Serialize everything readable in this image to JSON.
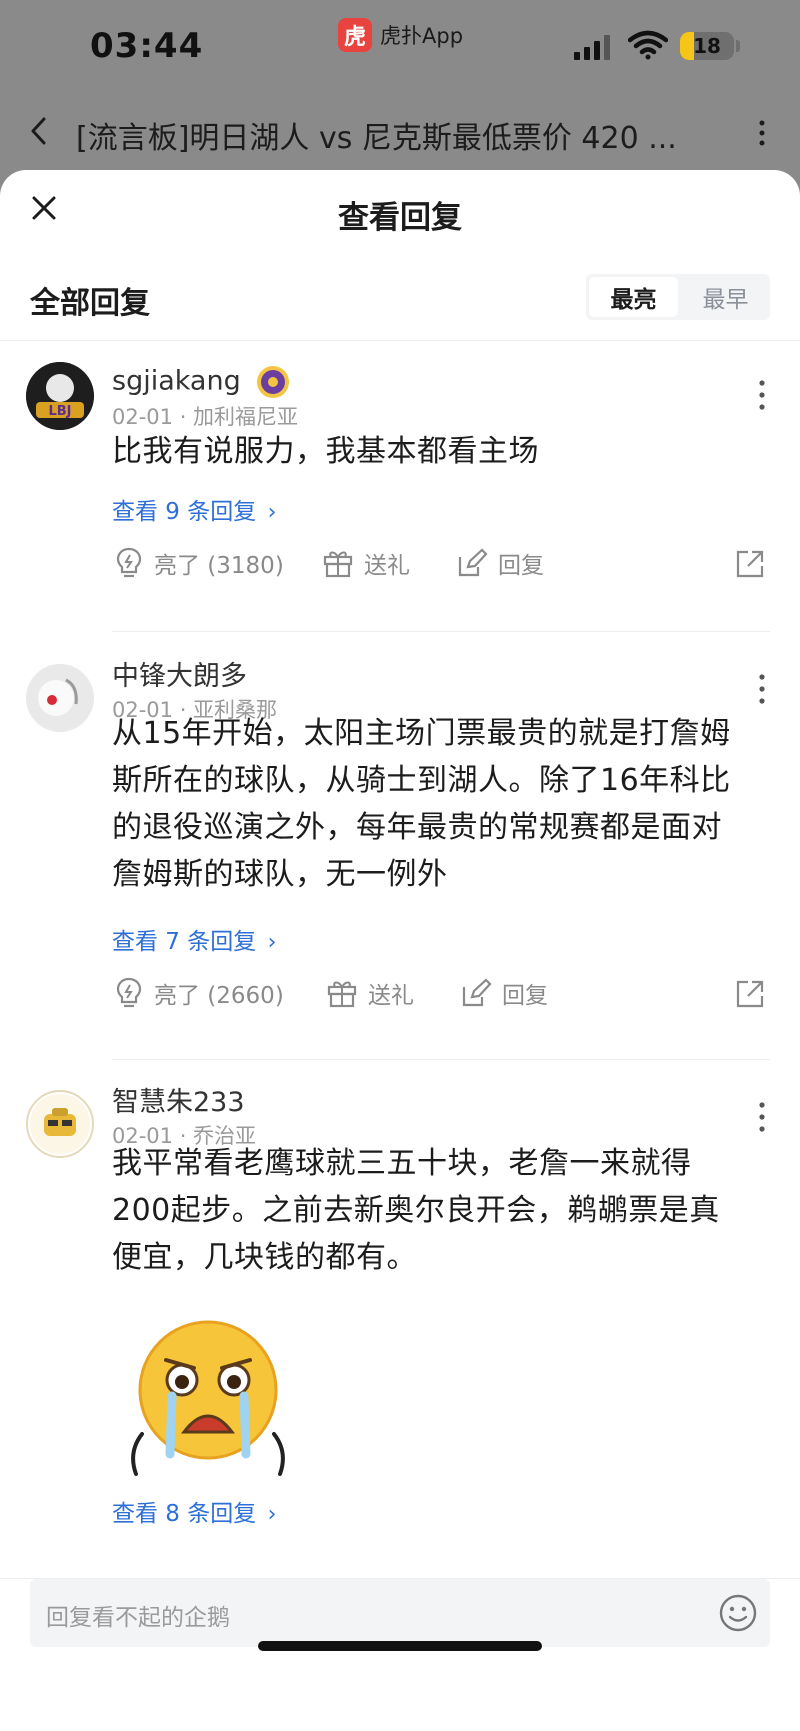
{
  "status_bar": {
    "time": "03:44",
    "app_name": "虎扑App",
    "app_logo_text": "虎扑",
    "battery": "18"
  },
  "header": {
    "thread_title": "[流言板]明日湖人 vs 尼克斯最低票价 420 ..."
  },
  "sheet": {
    "title": "查看回复",
    "section_title": "全部回复",
    "sort_options": [
      "最亮",
      "最早"
    ],
    "sort_selected": "最亮"
  },
  "comments": [
    {
      "username": "sgjiakang",
      "meta": "02-01 · 加利福尼亚",
      "text": "比我有说服力，我基本都看主场",
      "replies_link": "查看 9 条回复",
      "likes": "亮了 (3180)",
      "gift": "送礼",
      "reply": "回复"
    },
    {
      "username": "中锋大朗多",
      "meta": "02-01 · 亚利桑那",
      "text_lines": [
        "从15年开始，太阳主场门票最贵的就是打詹姆",
        "斯所在的球队，从骑士到湖人。除了16年科比",
        "的退役巡演之外，每年最贵的常规赛都是面对",
        "詹姆斯的球队，无一例外"
      ],
      "replies_link": "查看 7 条回复",
      "likes": "亮了 (2660)",
      "gift": "送礼",
      "reply": "回复"
    },
    {
      "username": "智慧朱233",
      "meta": "02-01 · 乔治亚",
      "text_lines": [
        "我平常看老鹰球就三五十块，老詹一来就得",
        " 200起步。之前去新奥尔良开会，鹈鹕票是真",
        "便宜，几块钱的都有。"
      ],
      "replies_link": "查看 8 条回复"
    }
  ],
  "reply_bar": {
    "placeholder": "回复看不起的企鹅"
  },
  "colors": {
    "link": "#2d6fd6",
    "app_red": "#e8433f",
    "battery": "#f5c518"
  }
}
